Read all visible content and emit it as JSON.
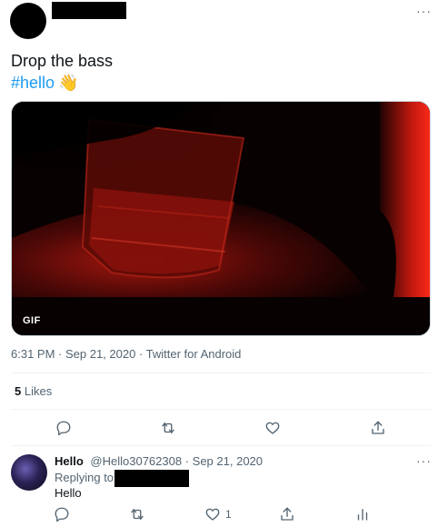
{
  "tweet": {
    "more_icon": "···",
    "text": "Drop the bass",
    "hashtag": "#hello",
    "emoji": "👋",
    "media_badge": "GIF",
    "timestamp": "6:31 PM · Sep 21, 2020 · Twitter for Android",
    "likes_count": "5",
    "likes_label": "Likes",
    "actions": [
      "reply-icon",
      "retweet-icon",
      "like-icon",
      "share-icon"
    ]
  },
  "reply": {
    "name": "Hello",
    "handle": "@Hello30762308",
    "date": "· Sep 21, 2020",
    "more_icon": "···",
    "replying_to_label": "Replying to",
    "text": "Hello",
    "like_count": "1",
    "actions": [
      "reply-icon",
      "retweet-icon",
      "like-icon",
      "share-icon",
      "analytics-icon"
    ]
  },
  "colors": {
    "link": "#1d9bf0",
    "muted": "#536471",
    "text": "#0f1419"
  }
}
